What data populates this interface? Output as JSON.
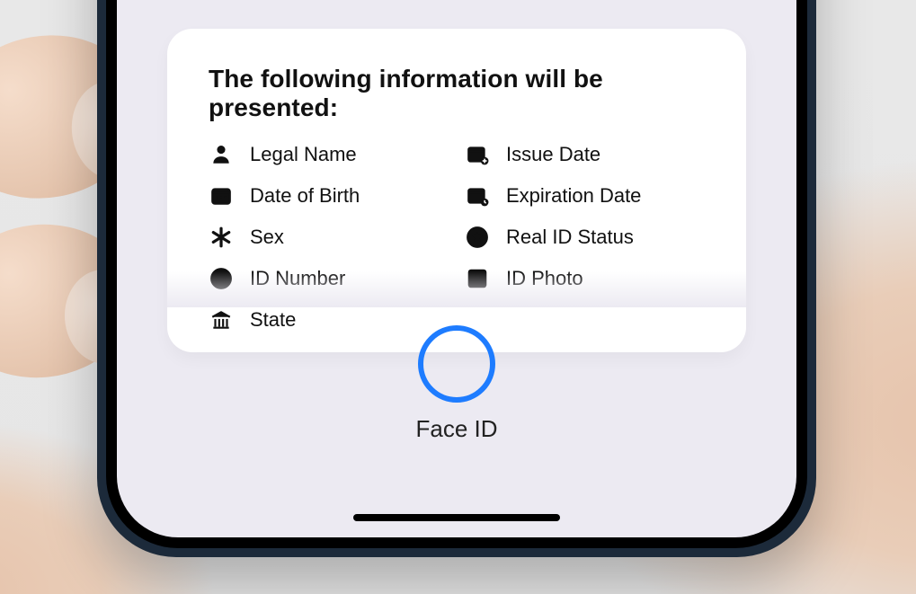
{
  "card": {
    "title": "The following information will be presented:",
    "leftItems": [
      {
        "icon": "person-icon",
        "label": "Legal Name"
      },
      {
        "icon": "calendar-icon",
        "label": "Date of Birth"
      },
      {
        "icon": "asterisk-icon",
        "label": "Sex"
      },
      {
        "icon": "hash-icon",
        "label": "ID Number"
      },
      {
        "icon": "state-icon",
        "label": "State"
      }
    ],
    "rightItems": [
      {
        "icon": "calendar-plus-icon",
        "label": "Issue Date"
      },
      {
        "icon": "calendar-clock-icon",
        "label": "Expiration Date"
      },
      {
        "icon": "star-circle-icon",
        "label": "Real ID Status"
      },
      {
        "icon": "photo-icon",
        "label": "ID Photo"
      }
    ]
  },
  "faceid": {
    "label": "Face ID"
  },
  "colors": {
    "accent": "#1e7cff"
  }
}
